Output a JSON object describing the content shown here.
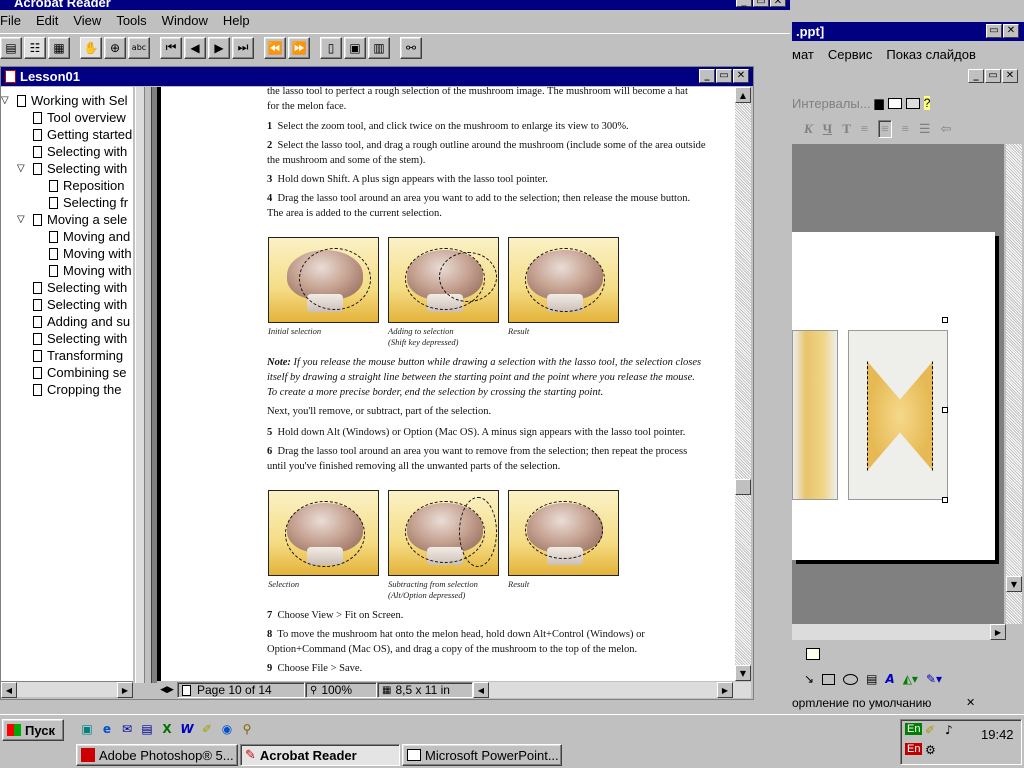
{
  "acrobat": {
    "title": "Acrobat Reader",
    "menu": [
      "File",
      "Edit",
      "View",
      "Tools",
      "Window",
      "Help"
    ],
    "doc_title": "Lesson01",
    "bookmarks": [
      {
        "label": "Working with Sel",
        "indent": 0,
        "expand": true
      },
      {
        "label": "Tool overview",
        "indent": 1,
        "expand": false
      },
      {
        "label": "Getting started",
        "indent": 1,
        "expand": false
      },
      {
        "label": "Selecting with",
        "indent": 1,
        "expand": false
      },
      {
        "label": "Selecting with",
        "indent": 1,
        "expand": true
      },
      {
        "label": "Reposition",
        "indent": 2,
        "expand": false
      },
      {
        "label": "Selecting fr",
        "indent": 2,
        "expand": false
      },
      {
        "label": "Moving a sele",
        "indent": 1,
        "expand": true
      },
      {
        "label": "Moving and",
        "indent": 2,
        "expand": false
      },
      {
        "label": "Moving with",
        "indent": 2,
        "expand": false
      },
      {
        "label": "Moving with",
        "indent": 2,
        "expand": false
      },
      {
        "label": "Selecting with",
        "indent": 1,
        "expand": false
      },
      {
        "label": "Selecting with",
        "indent": 1,
        "expand": false
      },
      {
        "label": "Adding and su",
        "indent": 1,
        "expand": false
      },
      {
        "label": "Selecting with",
        "indent": 1,
        "expand": false
      },
      {
        "label": "Transforming",
        "indent": 1,
        "expand": false
      },
      {
        "label": "Combining se",
        "indent": 1,
        "expand": false
      },
      {
        "label": "Cropping the",
        "indent": 1,
        "expand": false
      }
    ],
    "page_text": {
      "intro": "the lasso tool to perfect a rough selection of the mushroom image. The mushroom will become a hat for the melon face.",
      "step1_num": "1",
      "step1": "Select the zoom tool, and click twice on the mushroom to enlarge its view to 300%.",
      "step2_num": "2",
      "step2": "Select the lasso tool, and drag a rough outline around the mushroom (include some of the area outside the mushroom and some of the stem).",
      "step3_num": "3",
      "step3": "Hold down Shift. A plus sign appears with the lasso tool pointer.",
      "step4_num": "4",
      "step4": "Drag the lasso tool around an area you want to add to the selection; then release the mouse button. The area is added to the current selection.",
      "cap1": "Initial selection",
      "cap2a": "Adding to selection",
      "cap2b": "(Shift key depressed)",
      "cap3": "Result",
      "note_label": "Note:",
      "note": "If you release the mouse button while drawing a selection with the lasso tool, the selection closes itself by drawing a straight line between the starting point and the point where you release the mouse. To create a more precise border, end the selection by crossing the starting point.",
      "next": "Next, you'll remove, or subtract, part of the selection.",
      "step5_num": "5",
      "step5": "Hold down Alt (Windows) or Option (Mac OS). A minus sign appears with the lasso tool pointer.",
      "step6_num": "6",
      "step6": "Drag the lasso tool around an area you want to remove from the selection; then repeat the process until you've finished removing all the unwanted parts of the selection.",
      "cap4": "Selection",
      "cap5a": "Subtracting from selection",
      "cap5b": "(Alt/Option depressed)",
      "cap6": "Result",
      "step7_num": "7",
      "step7": "Choose View > Fit on Screen.",
      "step8_num": "8",
      "step8": "To move the mushroom hat onto the melon head, hold down Alt+Control (Windows) or Option+Command (Mac OS), and drag a copy of the mushroom to the top of the melon.",
      "step9_num": "9",
      "step9": "Choose File > Save."
    },
    "status": {
      "page": "Page 10 of 14",
      "zoom": "100%",
      "size": "8,5 x 11 in"
    }
  },
  "powerpoint": {
    "title": ".ppt]",
    "menu": [
      "мат",
      "Сервис",
      "Показ слайдов"
    ],
    "toolbar_label": "Интервалы...",
    "status": "орmление по умолчанию"
  },
  "taskbar": {
    "start": "Пуск",
    "tasks": [
      "Adobe Photoshop® 5...",
      "Acrobat Reader",
      "Microsoft PowerPoint..."
    ],
    "tray_lang1": "En",
    "tray_lang2": "En",
    "clock": "19:42"
  }
}
